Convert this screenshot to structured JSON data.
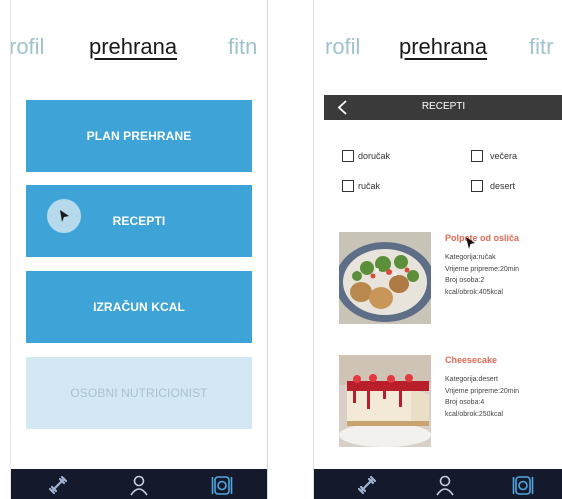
{
  "left_screen": {
    "tabs": {
      "prev": "rofil",
      "active": "prehrana",
      "next": "fitn"
    },
    "menu": {
      "plan": "PLAN PREHRANE",
      "recepti": "RECEPTI",
      "izracun": "IZRAČUN KCAL",
      "nutricionist": "OSOBNI NUTRICIONIST"
    },
    "nav": [
      "dumbbell-icon",
      "profile-icon",
      "plate-icon"
    ]
  },
  "right_screen": {
    "tabs": {
      "prev": "rofil",
      "active": "prehrana",
      "next": "fitr"
    },
    "header": {
      "title": "RECEPTI"
    },
    "filters": {
      "dorucak": "doručak",
      "vecera": "večera",
      "rucak": "ručak",
      "desert": "desert"
    },
    "recipes": [
      {
        "title": "Polpete od osliča",
        "kategorija": "Kategorija:ručak",
        "vrijeme": "Vrijeme pripreme:20min",
        "osobe": "Broj osoba:2",
        "kcal": "kcal/obrok:405kcal"
      },
      {
        "title": "Cheesecake",
        "kategorija": "Kategorija:desert",
        "vrijeme": "Vrijeme pripreme:20min",
        "osobe": "Broj osoba:4",
        "kcal": "kcal/obrok:250kcal"
      }
    ]
  },
  "colors": {
    "primary_blue": "#3ea3d6",
    "disabled_blue": "#d3e8f3",
    "tab_dim": "#9ec3cf",
    "nav_bg": "#141a2b",
    "header_bg": "#3a3a3a",
    "recipe_title": "#e06a55"
  }
}
